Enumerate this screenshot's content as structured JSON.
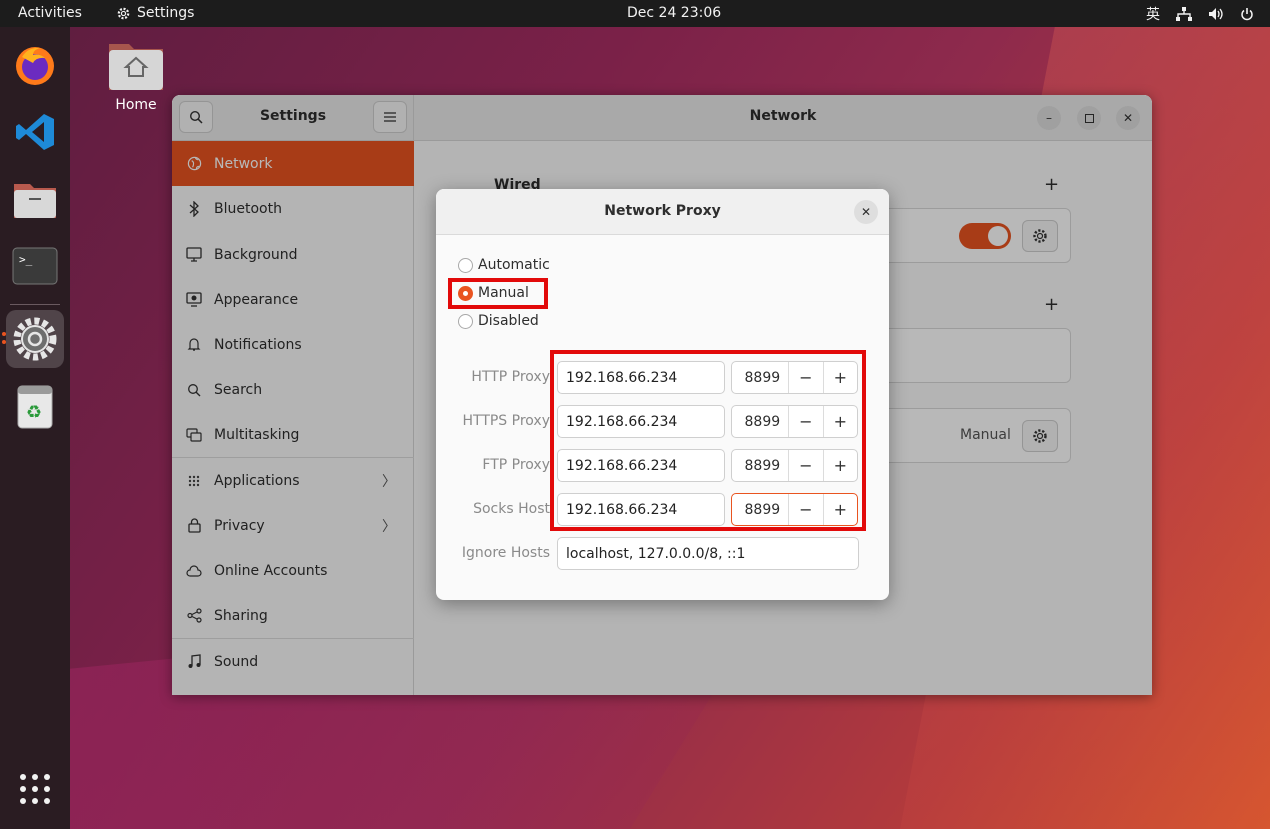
{
  "topbar": {
    "activities": "Activities",
    "app_name": "Settings",
    "clock": "Dec 24  23:06",
    "input_method": "英"
  },
  "desktop": {
    "home_label": "Home"
  },
  "dock": {
    "apps": [
      "firefox-icon",
      "vscode-icon",
      "files-icon",
      "terminal-icon",
      "settings-icon",
      "trash-icon",
      "app-grid-icon"
    ]
  },
  "settings": {
    "sidebar_title": "Settings",
    "main_title": "Network",
    "sidebar_items": [
      {
        "label": "Network",
        "icon": "network-icon"
      },
      {
        "label": "Bluetooth",
        "icon": "bluetooth-icon"
      },
      {
        "label": "Background",
        "icon": "background-icon"
      },
      {
        "label": "Appearance",
        "icon": "appearance-icon"
      },
      {
        "label": "Notifications",
        "icon": "bell-icon"
      },
      {
        "label": "Search",
        "icon": "search-icon"
      },
      {
        "label": "Multitasking",
        "icon": "multitasking-icon"
      },
      {
        "label": "Applications",
        "icon": "apps-icon"
      },
      {
        "label": "Privacy",
        "icon": "lock-icon"
      },
      {
        "label": "Online Accounts",
        "icon": "cloud-icon"
      },
      {
        "label": "Sharing",
        "icon": "share-icon"
      },
      {
        "label": "Sound",
        "icon": "music-icon"
      }
    ],
    "network": {
      "wired_heading": "Wired",
      "proxy_status": "Manual"
    }
  },
  "proxy_dialog": {
    "title": "Network Proxy",
    "modes": [
      "Automatic",
      "Manual",
      "Disabled"
    ],
    "selected_mode": "Manual",
    "rows": [
      {
        "label": "HTTP Proxy",
        "host": "192.168.66.234",
        "port": "8899"
      },
      {
        "label": "HTTPS Proxy",
        "host": "192.168.66.234",
        "port": "8899"
      },
      {
        "label": "FTP Proxy",
        "host": "192.168.66.234",
        "port": "8899"
      },
      {
        "label": "Socks Host",
        "host": "192.168.66.234",
        "port": "8899"
      }
    ],
    "ignore_label": "Ignore Hosts",
    "ignore_hosts": "localhost, 127.0.0.0/8, ::1",
    "minus": "−",
    "plus": "+"
  },
  "colors": {
    "accent": "#e95420",
    "highlight": "#e20a0a"
  }
}
